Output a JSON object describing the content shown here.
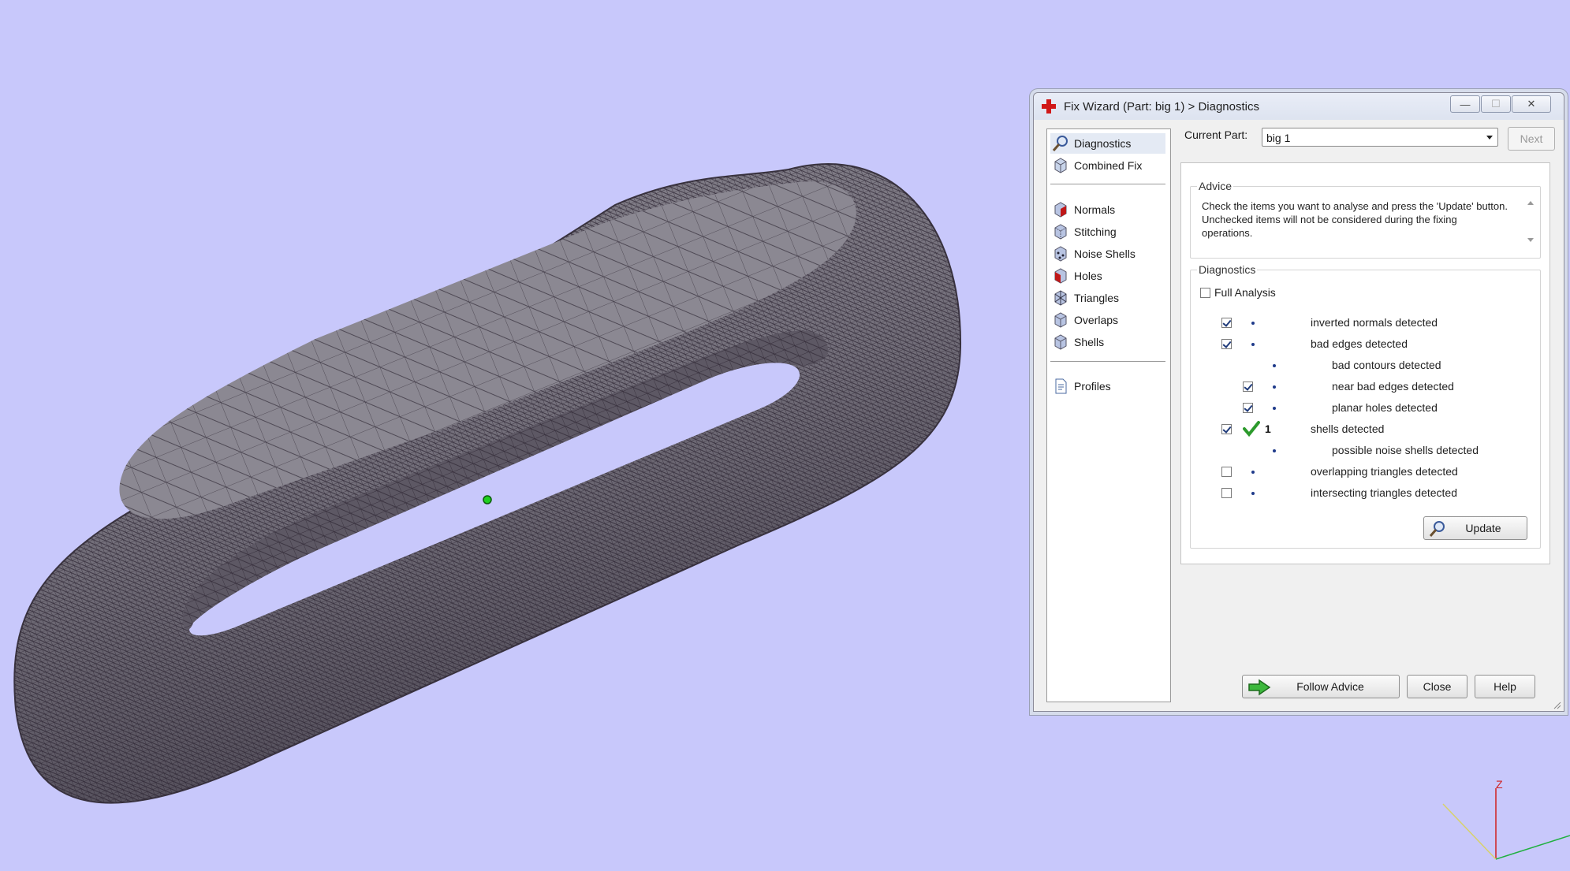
{
  "window": {
    "title": "Fix Wizard (Part: big 1) > Diagnostics",
    "min_symbol": "—",
    "max_symbol": "☐",
    "close_symbol": "✕"
  },
  "sidebar": {
    "items": [
      {
        "label": "Diagnostics",
        "icon": "magnifier-icon",
        "selected": true
      },
      {
        "label": "Combined Fix",
        "icon": "cube-icon"
      },
      {
        "label": "Normals",
        "icon": "normals-cube-icon"
      },
      {
        "label": "Stitching",
        "icon": "stitching-cube-icon"
      },
      {
        "label": "Noise Shells",
        "icon": "noise-shells-cube-icon"
      },
      {
        "label": "Holes",
        "icon": "holes-cube-icon"
      },
      {
        "label": "Triangles",
        "icon": "triangles-cube-icon"
      },
      {
        "label": "Overlaps",
        "icon": "overlaps-cube-icon"
      },
      {
        "label": "Shells",
        "icon": "shells-cube-icon"
      },
      {
        "label": "Profiles",
        "icon": "document-icon"
      }
    ]
  },
  "current_part": {
    "label": "Current Part:",
    "value": "big 1",
    "next_label": "Next"
  },
  "advice": {
    "title": "Advice",
    "text": "Check the items you want to analyse and press the 'Update' button. Unchecked items will not be considered during the fixing operations."
  },
  "diagnostics": {
    "title": "Diagnostics",
    "full_analysis": {
      "label": "Full Analysis",
      "checked": false
    },
    "rows": [
      {
        "label": "inverted normals detected",
        "checked": true
      },
      {
        "label": "bad edges detected",
        "checked": true
      },
      {
        "label": "bad contours detected"
      },
      {
        "label": "near bad edges detected",
        "checked": true
      },
      {
        "label": "planar holes detected",
        "checked": true
      },
      {
        "label": "shells detected",
        "checked": true,
        "count": "1"
      },
      {
        "label": "possible noise shells detected"
      },
      {
        "label": "overlapping triangles detected",
        "checked": false
      },
      {
        "label": "intersecting triangles detected",
        "checked": false
      }
    ],
    "update_label": "Update"
  },
  "footer": {
    "follow_advice_label": "Follow Advice",
    "close_label": "Close",
    "help_label": "Help"
  },
  "axes": {
    "z_label": "Z"
  },
  "colors": {
    "background": "#c8c8fb",
    "mesh": "#5d5a66",
    "accent_green": "#2c9a2c",
    "red_cross": "#d01818"
  }
}
